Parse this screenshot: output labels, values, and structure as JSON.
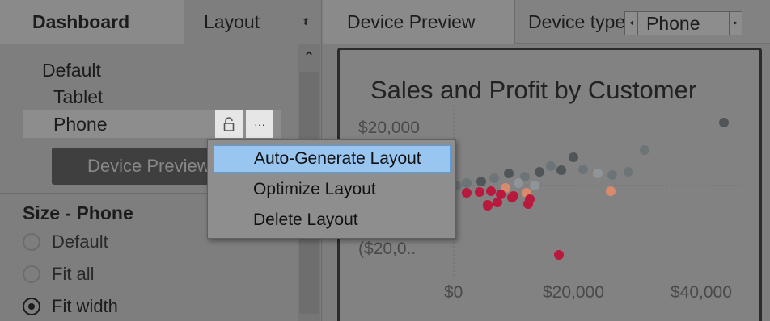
{
  "tabs": {
    "dashboard": "Dashboard",
    "layout": "Layout",
    "layout_spinner": "⬍",
    "device_preview": "Device Preview",
    "device_type_label": "Device type",
    "device_type_value": "Phone"
  },
  "layouts": {
    "items": [
      "Default",
      "Tablet",
      "Phone"
    ],
    "lock_icon": "unlock-icon",
    "more_icon": "ellipsis-icon"
  },
  "preview_button": "Device Preview",
  "size": {
    "heading": "Size - Phone",
    "options": [
      {
        "label": "Default",
        "selected": false
      },
      {
        "label": "Fit all",
        "selected": false
      },
      {
        "label": "Fit width",
        "selected": true
      }
    ]
  },
  "context_menu": {
    "items": [
      "Auto-Generate Layout",
      "Optimize Layout",
      "Delete Layout"
    ],
    "highlighted_index": 0
  },
  "chart": {
    "title": "Sales and Profit by Customer",
    "y_ticks": [
      "$20,000",
      "($20,0.."
    ],
    "x_ticks": [
      "$0",
      "$20,000",
      "$40,000"
    ]
  },
  "colors": {
    "highlight": "#98c6f0",
    "point_dark": "#505558",
    "point_mid": "#6d7478",
    "point_gray": "#8f9498",
    "point_red": "#b8193c",
    "point_orange": "#d98a6b"
  }
}
